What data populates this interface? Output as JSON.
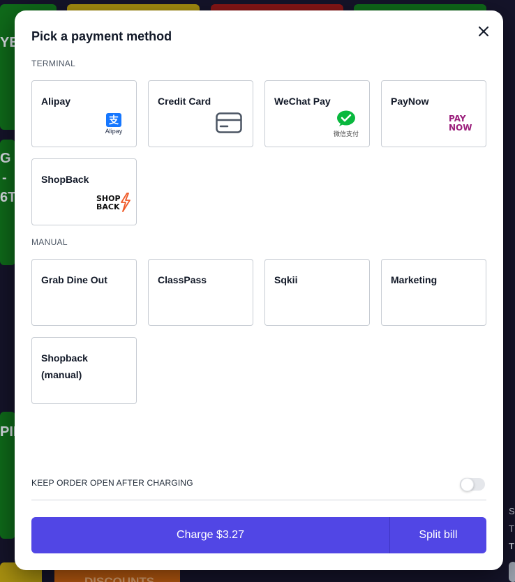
{
  "background": {
    "tile_texts": [
      "YES",
      "G",
      "-",
      "6T",
      "PIE",
      "DISCOUNTS",
      "S",
      "T",
      "T"
    ]
  },
  "modal": {
    "title": "Pick a payment method",
    "close_icon": "close-icon"
  },
  "sections": {
    "terminal": {
      "label": "TERMINAL",
      "methods": [
        {
          "label": "Alipay",
          "logo": "alipay-logo",
          "logo_text": "Alipay"
        },
        {
          "label": "Credit Card",
          "logo": "credit-card-icon"
        },
        {
          "label": "WeChat Pay",
          "logo": "wechat-pay-logo",
          "logo_text": "微信支付"
        },
        {
          "label": "PayNow",
          "logo": "paynow-logo",
          "logo_text": "PAY NOW"
        },
        {
          "label": "ShopBack",
          "logo": "shopback-logo",
          "logo_text": "SHOP BACK"
        }
      ]
    },
    "manual": {
      "label": "MANUAL",
      "methods": [
        {
          "label": "Grab Dine Out"
        },
        {
          "label": "ClassPass"
        },
        {
          "label": "Sqkii"
        },
        {
          "label": "Marketing"
        },
        {
          "label": "Shopback (manual)"
        }
      ]
    }
  },
  "options": {
    "keep_open_label": "KEEP ORDER OPEN AFTER CHARGING",
    "keep_open_enabled": false
  },
  "actions": {
    "charge_label": "Charge $3.27",
    "split_label": "Split bill"
  },
  "colors": {
    "primary": "#5146e5",
    "alipay": "#1677ff",
    "wechat": "#09b83e",
    "paynow": "#9b1f7c",
    "shopback": "#f05a28"
  }
}
